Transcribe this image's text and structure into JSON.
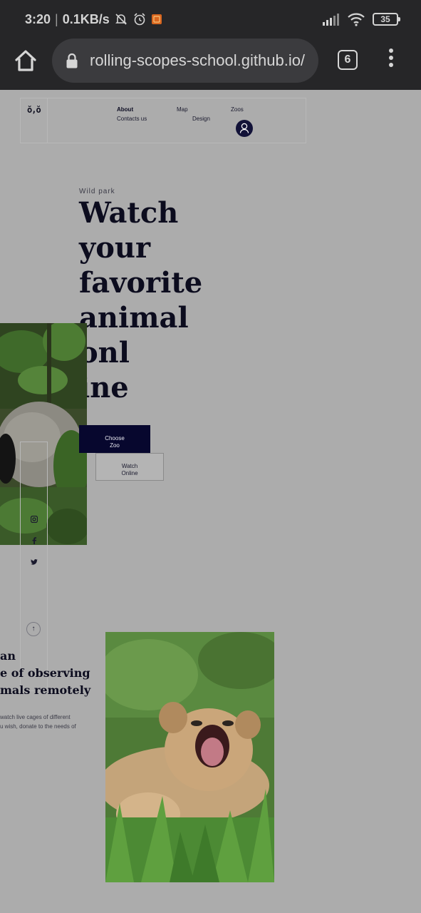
{
  "status_bar": {
    "time": "3:20",
    "separator": "|",
    "net_speed": "0.1KB/s",
    "battery": "35",
    "icons": [
      "mute-bell-icon",
      "alarm-clock-icon",
      "app-notification-icon",
      "signal-icon",
      "wifi-icon",
      "battery-icon"
    ]
  },
  "browser": {
    "url": "rolling-scopes-school.github.io/",
    "tab_count": "6",
    "icons": [
      "home-icon",
      "lock-icon",
      "tabs-icon",
      "menu-dots-icon"
    ]
  },
  "site": {
    "logo": "ŏ,ŏ",
    "nav": {
      "about": "About",
      "map": "Map",
      "zoos": "Zoos",
      "contacts": "Contacts us",
      "design": "Design"
    },
    "hero": {
      "eyebrow": "Wild park",
      "title_lines": [
        "Watch",
        "your",
        "favorite",
        "animal",
        "onl",
        "ine"
      ],
      "choose_line1": "Choose",
      "choose_line2": "Zoo",
      "watch_line1": "Watch",
      "watch_line2": "Online"
    },
    "section": {
      "title_lines": [
        "an",
        "e of observing",
        "mals remotely"
      ],
      "text_lines": [
        "watch live cages of different",
        "u wish, donate to the needs of"
      ]
    },
    "up_arrow": "↑"
  },
  "colors": {
    "chrome_bg": "#262628",
    "page_bg": "#acacac",
    "accent_navy": "#07072e",
    "dot_red": "#c0121c"
  }
}
